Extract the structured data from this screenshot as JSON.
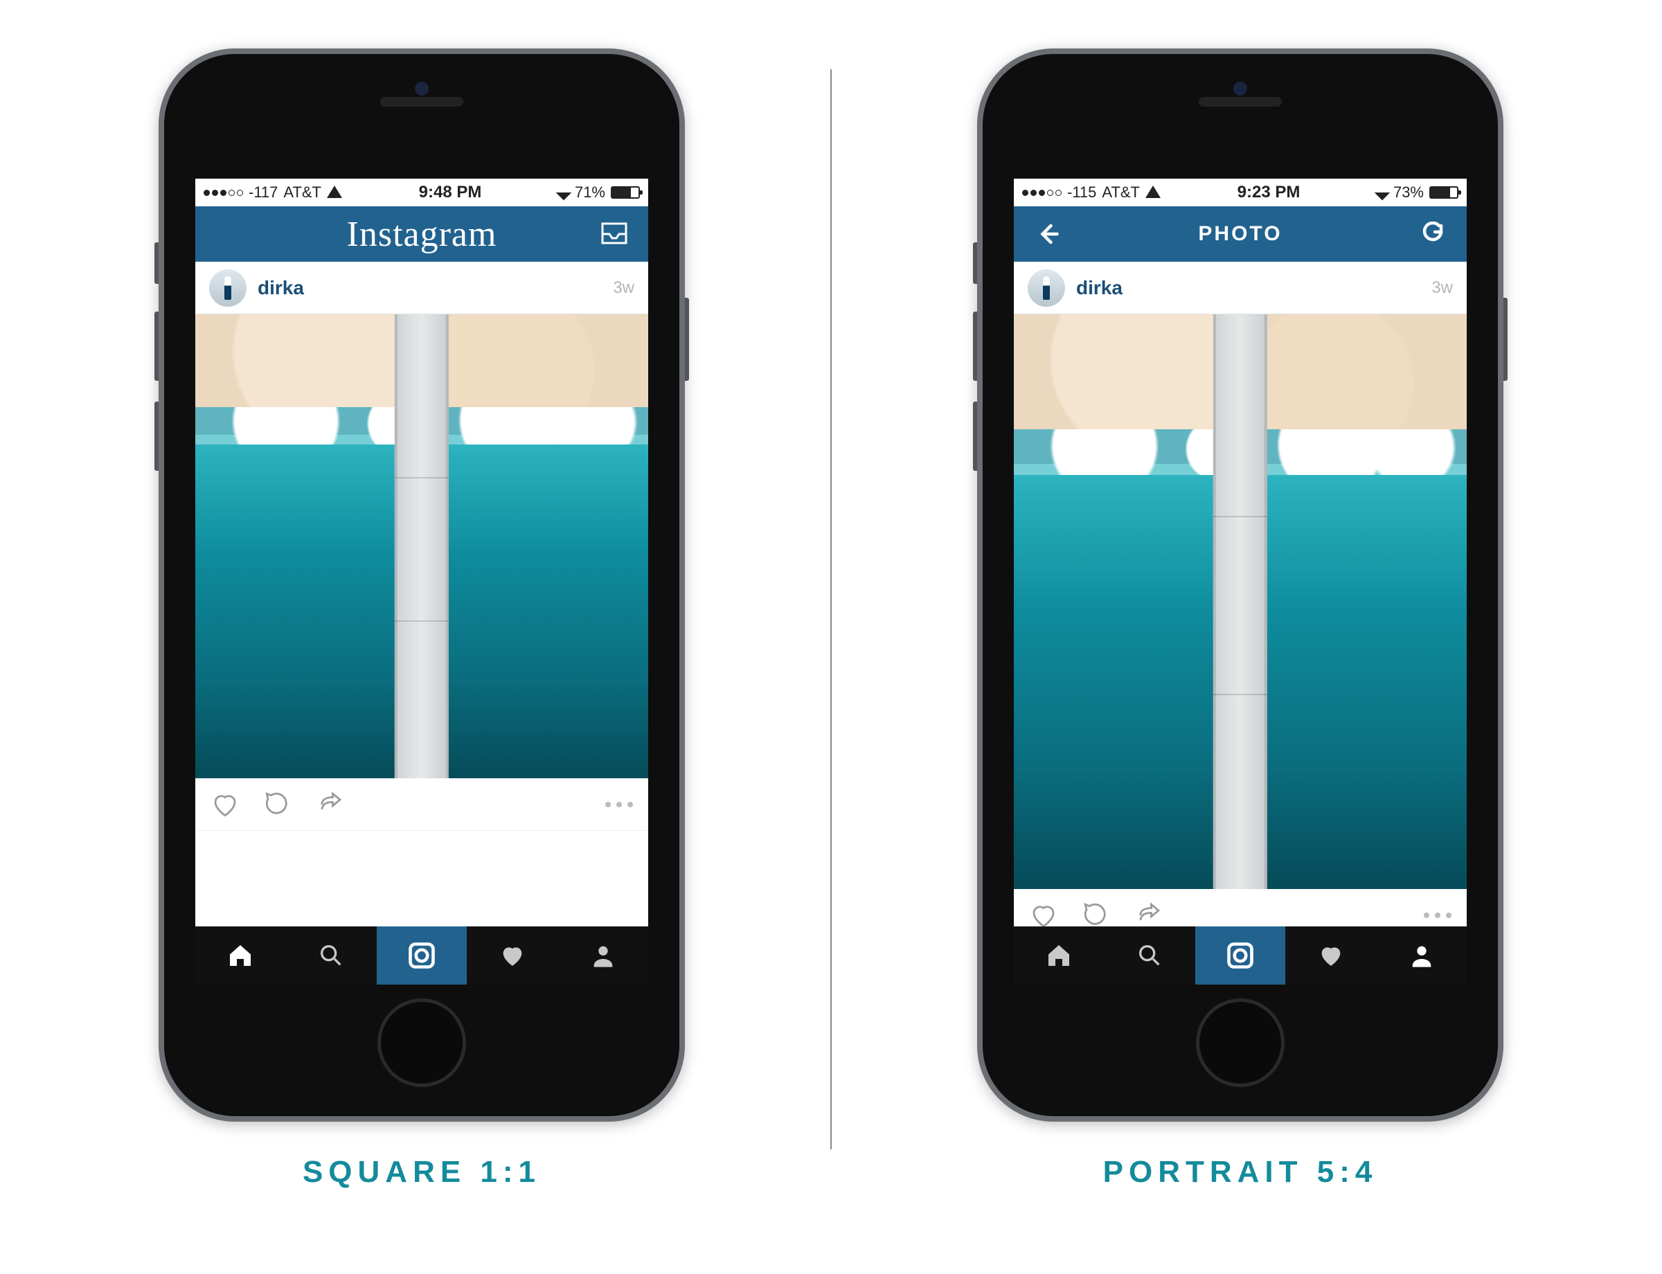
{
  "captions": {
    "left": "Square 1:1",
    "right": "Portrait 5:4"
  },
  "phones": {
    "left": {
      "status": {
        "signal_text": "-117",
        "carrier": "AT&T",
        "time": "9:48 PM",
        "battery_pct": "71%"
      },
      "nav": {
        "mode": "feed",
        "title": "Instagram"
      },
      "post": {
        "username": "dirka",
        "time_ago": "3w",
        "aspect": "square"
      }
    },
    "right": {
      "status": {
        "signal_text": "-115",
        "carrier": "AT&T",
        "time": "9:23 PM",
        "battery_pct": "73%"
      },
      "nav": {
        "mode": "photo",
        "title": "PHOTO"
      },
      "post": {
        "username": "dirka",
        "time_ago": "3w",
        "aspect": "portrait"
      }
    }
  },
  "tabs": [
    "home",
    "search",
    "camera",
    "activity",
    "profile"
  ],
  "active_tab": "camera"
}
